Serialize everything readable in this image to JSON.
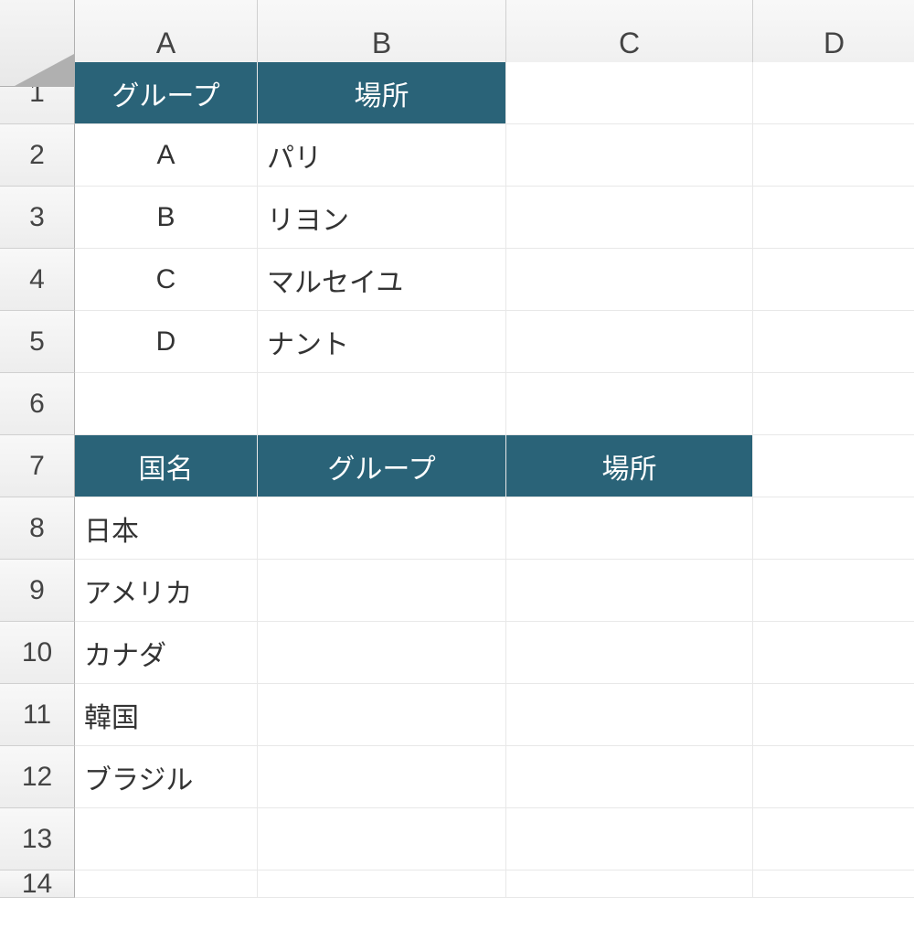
{
  "columns": [
    "A",
    "B",
    "C",
    "D"
  ],
  "rows": [
    "1",
    "2",
    "3",
    "4",
    "5",
    "6",
    "7",
    "8",
    "9",
    "10",
    "11",
    "12",
    "13",
    "14"
  ],
  "table1": {
    "headers": {
      "group": "グループ",
      "location": "場所"
    },
    "rows": [
      {
        "group": "A",
        "location": "パリ"
      },
      {
        "group": "B",
        "location": "リヨン"
      },
      {
        "group": "C",
        "location": "マルセイユ"
      },
      {
        "group": "D",
        "location": "ナント"
      }
    ]
  },
  "table2": {
    "headers": {
      "country": "国名",
      "group": "グループ",
      "location": "場所"
    },
    "rows": [
      {
        "country": "日本"
      },
      {
        "country": "アメリカ"
      },
      {
        "country": "カナダ"
      },
      {
        "country": "韓国"
      },
      {
        "country": "ブラジル"
      }
    ]
  },
  "colors": {
    "header_bg": "#2a6378",
    "header_fg": "#ffffff"
  }
}
